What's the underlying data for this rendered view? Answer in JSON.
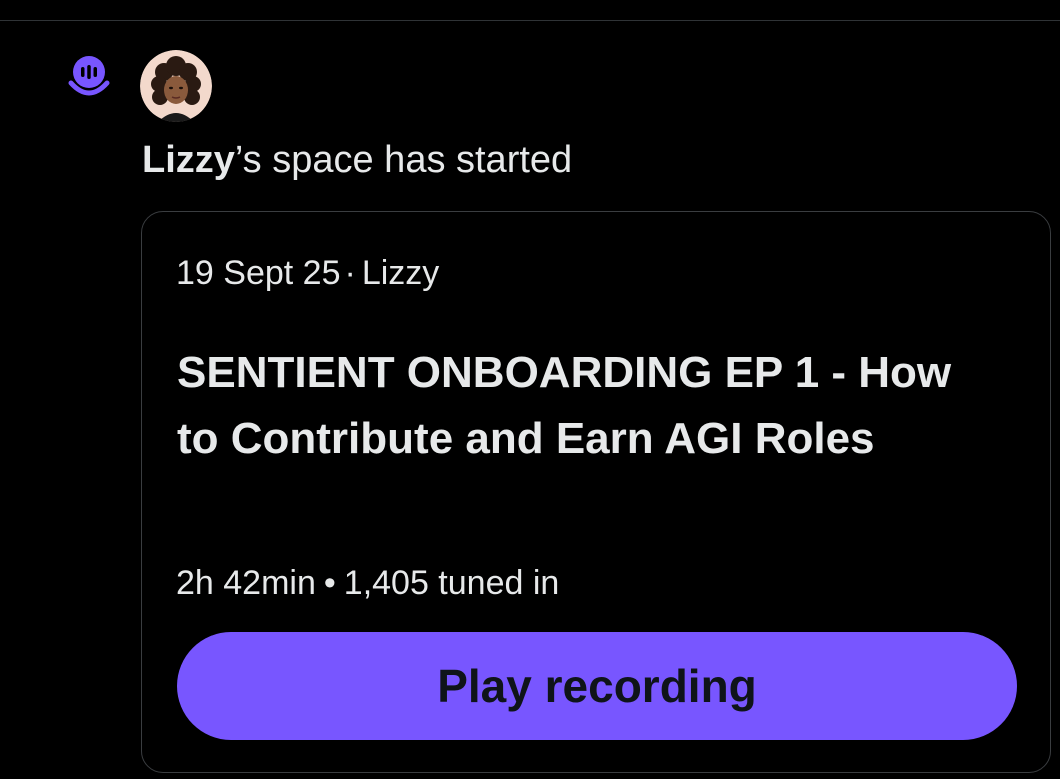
{
  "colors": {
    "background": "#000000",
    "accent": "#7856ff",
    "text": "#e7e9ea",
    "card_border": "#3a3d40"
  },
  "icons": {
    "type_icon": "spaces-icon",
    "host_avatar": "avatar"
  },
  "notification": {
    "host_name": "Lizzy",
    "headline_suffix": "’s space has started"
  },
  "space_card": {
    "date": "19 Sept 25",
    "separator": "·",
    "host": "Lizzy",
    "title": "SENTIENT ONBOARDING EP 1 - How to Contribute and Earn AGI Roles",
    "duration": "2h 42min",
    "bullet": "•",
    "listeners": "1,405 tuned in",
    "play_label": "Play recording"
  }
}
